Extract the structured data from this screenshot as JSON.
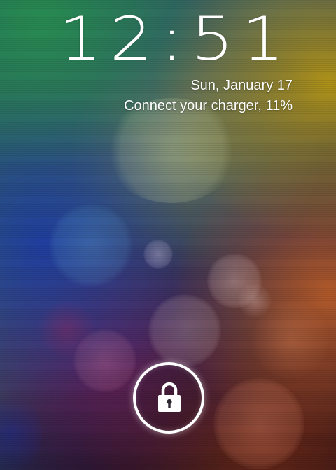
{
  "lockscreen": {
    "time": "12:51",
    "date": "Sun, January 17",
    "battery_status": "Connect your charger, 11%",
    "unlock_icon": "lock-icon"
  },
  "colors": {
    "text": "#ffffff",
    "ring": "#ffffff"
  }
}
